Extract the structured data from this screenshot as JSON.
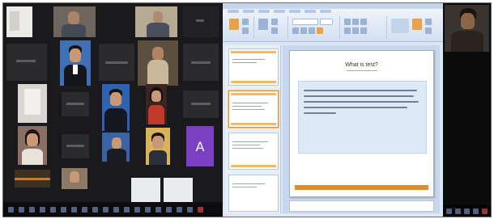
{
  "conference": {
    "participants": [
      {
        "name": "",
        "initial": ""
      },
      {
        "name": "",
        "initial": ""
      },
      {
        "name": "",
        "initial": ""
      },
      {
        "name": "",
        "initial": ""
      },
      {
        "name": "",
        "initial": "A"
      }
    ]
  },
  "slide": {
    "title": "What is test?",
    "body": ""
  },
  "colors": {
    "accent": "#e08a2f",
    "ribbon": "#d3e0f1",
    "conference_bg": "#1a1a1c",
    "avatar_purple": "#7b3fc4"
  }
}
